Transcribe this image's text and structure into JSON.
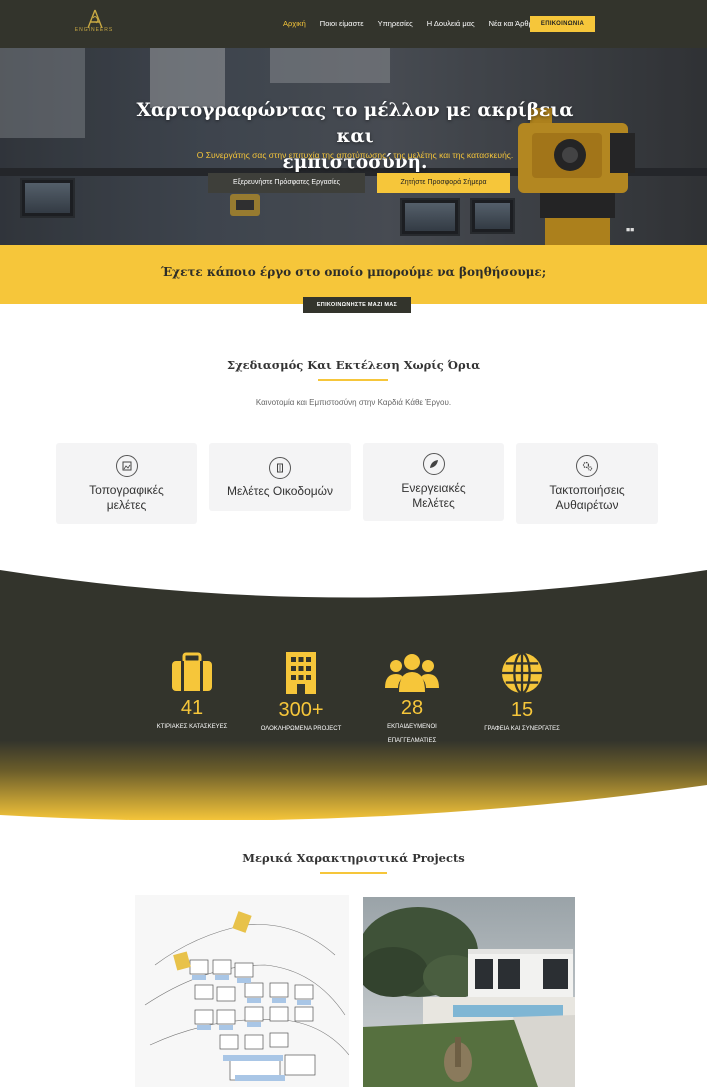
{
  "header": {
    "logo_text": "ENGINEERS",
    "nav": [
      {
        "label": "Αρχική",
        "active": true
      },
      {
        "label": "Ποιοι είμαστε",
        "active": false
      },
      {
        "label": "Υπηρεσίες",
        "active": false
      },
      {
        "label": "Η Δουλειά μας",
        "active": false
      },
      {
        "label": "Νέα και Άρθρα",
        "active": false
      }
    ],
    "cta_label": "ΕΠΙΚΟΙΝΩΝΙΑ"
  },
  "hero": {
    "title_line1": "Χαρτογραφώντας το μέλλον με ακρίβεια και",
    "title_line2": "εμπιστοσύνη.",
    "subtitle": "Ο Συνεργάτης σας στην επιτυχία της αποτύπωσης , της μελέτης  και της κατασκευής.",
    "button_primary": "Εξερευνήστε Πρόσφατες Εργασίες",
    "button_secondary": "Ζητήστε Προσφορά Σήμερα",
    "scroll_indicator": "◼◼"
  },
  "cta_band": {
    "title": "Έχετε κάποιο έργο στο οποίο μπορούμε να βοηθήσουμε;",
    "button": "ΕΠΙΚΟΙΝΩΝΗΣΤΕ ΜΑΖΙ ΜΑΣ"
  },
  "services": {
    "title": "Σχεδιασμός Και Εκτέλεση Χωρίς Όρια",
    "subtitle": "Καινοτομία και Εμπιστοσύνη στην Καρδιά Κάθε Έργου.",
    "cards": [
      {
        "label_line1": "Τοπογραφικές",
        "label_line2": "μελέτες",
        "icon": "image-icon"
      },
      {
        "label_line1": "Μελέτες Οικοδομών",
        "label_line2": "",
        "icon": "building-icon"
      },
      {
        "label_line1": "Ενεργειακές",
        "label_line2": "Μελέτες",
        "icon": "leaf-icon"
      },
      {
        "label_line1": "Τακτοποιήσεις",
        "label_line2": "Αυθαιρέτων",
        "icon": "cogs-icon"
      }
    ]
  },
  "stats": [
    {
      "value": "41",
      "label_line1": "ΚΤΙΡΙΑΚΕΣ ΚΑΤΑΣΚΕΥΕΣ",
      "label_line2": "",
      "icon": "suitcase-icon"
    },
    {
      "value": "300+",
      "label_line1": "ΟΛΟΚΛΗΡΩΜΕΝΑ PROJECT",
      "label_line2": "",
      "icon": "office-building-icon"
    },
    {
      "value": "28",
      "label_line1": "ΕΚΠΑΙΔΕΥΜΕΝΟΙ",
      "label_line2": "ΕΠΑΓΓΕΛΜΑΤΙΕΣ",
      "icon": "users-icon"
    },
    {
      "value": "15",
      "label_line1": "ΓΡΑΦΕΙΑ ΚΑΙ ΣΥΝΕΡΓΑΤΕΣ",
      "label_line2": "",
      "icon": "globe-icon"
    }
  ],
  "projects": {
    "title": "Μερικά Χαρακτηριστικά Projects"
  },
  "colors": {
    "dark": "#33342c",
    "accent": "#f6c63a",
    "card_bg": "#f4f4f5"
  }
}
